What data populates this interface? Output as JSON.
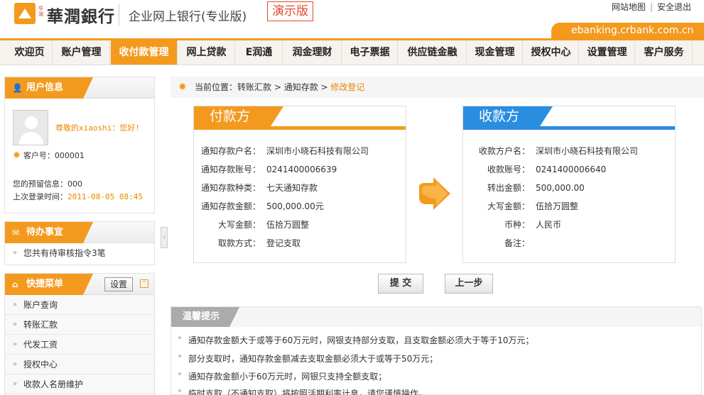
{
  "header": {
    "logo_small": "华润",
    "logo_name": "華潤銀行",
    "app_name": "企业网上银行(专业版)",
    "demo_tag": "演示版",
    "links": [
      "网站地图",
      "安全退出"
    ],
    "url": "ebanking.crbank.com.cn"
  },
  "nav": {
    "items": [
      "欢迎页",
      "账户管理",
      "收付款管理",
      "网上贷款",
      "E润通",
      "润金理财",
      "电子票据",
      "供应链金融",
      "现金管理",
      "授权中心",
      "设置管理",
      "客户服务"
    ],
    "active": "收付款管理"
  },
  "user_box": {
    "title": "用户信息",
    "greeting": "尊敬的xiaoshi：您好!",
    "customer_no_label": "客户号：",
    "customer_no": "000001",
    "reserved_label": "您的预留信息：",
    "reserved": "000",
    "last_login_label": "上次登录时间：",
    "last_login": "2011-08-05 08:45"
  },
  "todo_box": {
    "title": "待办事宜",
    "items": [
      "您共有待审核指令3笔"
    ]
  },
  "shortcut_box": {
    "title": "快捷菜单",
    "settings_label": "设置",
    "items": [
      "账户查询",
      "转账汇款",
      "代发工资",
      "授权中心",
      "收款人名册维护"
    ]
  },
  "breadcrumb": {
    "prefix": "当前位置：",
    "parts": [
      "转账汇款",
      "通知存款"
    ],
    "current": "修改登记",
    "separator": " > "
  },
  "payer": {
    "title": "付款方",
    "rows": [
      {
        "label": "通知存款户名：",
        "value": "深圳市小晓石科技有限公司"
      },
      {
        "label": "通知存款账号：",
        "value": "0241400006639"
      },
      {
        "label": "通知存款种类：",
        "value": "七天通知存款"
      },
      {
        "label": "通知存款金额：",
        "value": "500,000.00元"
      },
      {
        "label": "大写金额：",
        "value": "伍拾万圆整"
      },
      {
        "label": "取款方式：",
        "value": "登记支取"
      }
    ]
  },
  "payee": {
    "title": "收款方",
    "rows": [
      {
        "label": "收款方户名：",
        "value": "深圳市小晓石科技有限公司"
      },
      {
        "label": "收款账号：",
        "value": "0241400006640"
      },
      {
        "label": "转出金额：",
        "value": "500,000.00"
      },
      {
        "label": "大写金额：",
        "value": "伍拾万圆整"
      },
      {
        "label": "币种：",
        "value": "人民币"
      },
      {
        "label": "备注：",
        "value": ""
      }
    ]
  },
  "buttons": {
    "submit": "提 交",
    "back": "上一步"
  },
  "tips": {
    "title": "温馨提示",
    "items": [
      "通知存款金额大于或等于60万元时，网银支持部分支取，且支取金额必须大于等于10万元；",
      "部分支取时，通知存款金额减去支取金额必须大于或等于50万元；",
      "通知存款金额小于60万元时，网银只支持全额支取；",
      "临时支取（不通知支取）将按照活期利率计息，请您谨慎操作。"
    ]
  },
  "colors": {
    "accent_orange": "#f39a1e",
    "payee_blue": "#2a8ee0",
    "demo_red": "#e04a2a"
  }
}
